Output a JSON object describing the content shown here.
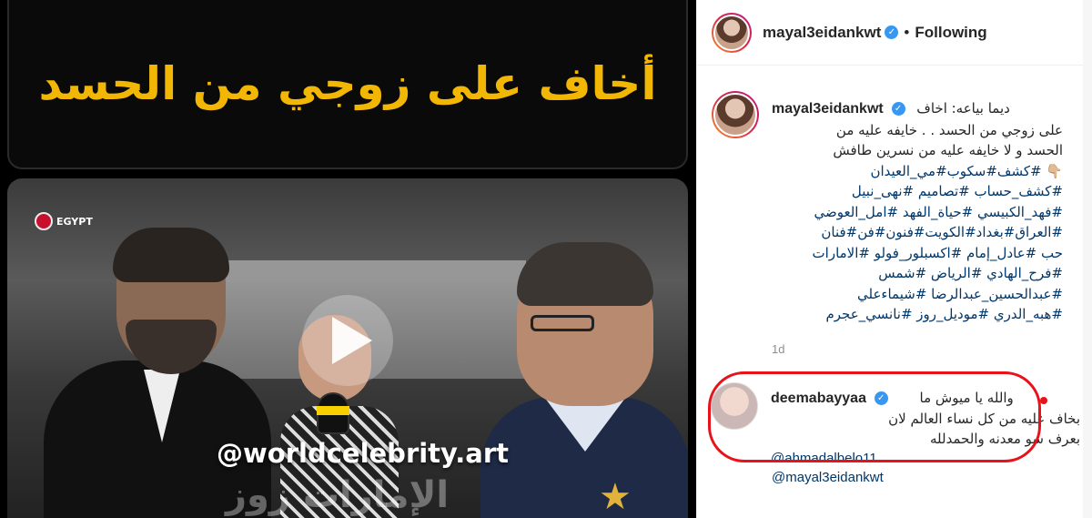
{
  "media": {
    "caption_text": "أخاف على زوجي من الحسد",
    "watermark": "@worldcelebrity.art",
    "bottom_overlay_text": "الإمارات زوز",
    "logo_text": "EGYPT"
  },
  "header": {
    "username": "mayal3eidankwt",
    "separator": "•",
    "follow_status": "Following"
  },
  "post": {
    "username": "mayal3eidankwt",
    "caption_lines": [
      "ديما بياعه: اخاف",
      "على زوجي من الحسد . . خايفه عليه من",
      "الحسد و لا خايفه عليه من نسرين طافش",
      "👇🏼 #كشف#سكوب#مي_العيدان"
    ],
    "hashtag_lines": [
      "#كشف_حساب #تصاميم #نهى_نبيل",
      "#فهد_الكبيسي #حياة_الفهد #امل_العوضي",
      "#العراق#بغداد#الكويت#فنون#فن#فنان",
      "حب #عادل_إمام #اكسبلور_فولو #الامارات",
      "#فرح_الهادي #الرياض #شمس",
      "#عبدالحسين_عبدالرضا #شيماءعلي",
      "#هبه_الدري #موديل_روز #نانسي_عجرم"
    ],
    "time_ago": "1d"
  },
  "comment": {
    "username": "deemabayyaa",
    "lines": [
      "والله يا ميوش ما",
      "بخاف عليه من كل نساء العالم لان",
      "بعرف شو معدنه والحمدلله"
    ],
    "mention_partial": "@ahmadalbelo11",
    "mention": "@mayal3eidankwt"
  },
  "colors": {
    "caption_gold": "#f2b705",
    "verified_blue": "#3897f0",
    "link_blue": "#00376b",
    "highlight_red": "#e8121b",
    "muted_gray": "#8e8e8e"
  }
}
